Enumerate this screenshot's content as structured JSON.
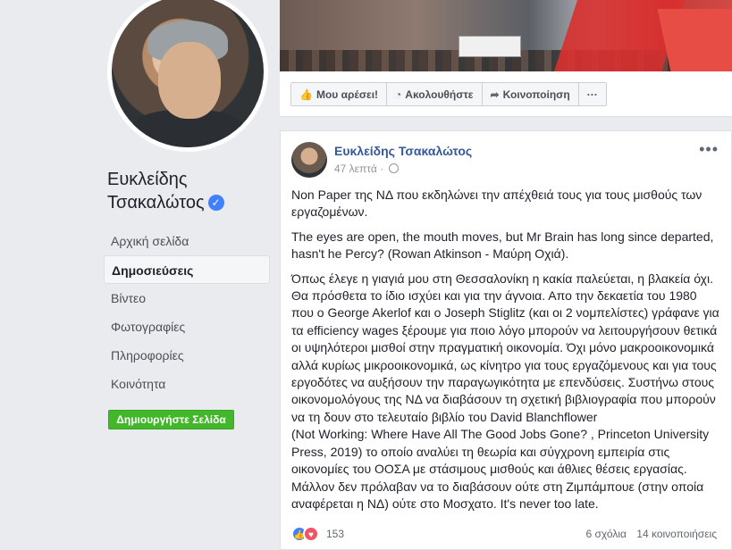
{
  "page": {
    "name_line1": "Ευκλείδης",
    "name_line2": "Τσακαλώτος",
    "verified_glyph": "✓"
  },
  "nav": {
    "items": [
      {
        "label": "Αρχική σελίδα"
      },
      {
        "label": "Δημοσιεύσεις",
        "active": true
      },
      {
        "label": "Βίντεο"
      },
      {
        "label": "Φωτογραφίες"
      },
      {
        "label": "Πληροφορίες"
      },
      {
        "label": "Κοινότητα"
      }
    ],
    "create_page": "Δημιουργήστε Σελίδα"
  },
  "actions": {
    "like": "Μου αρέσει!",
    "follow": "Ακολουθήστε",
    "share": "Κοινοποίηση",
    "more": "···"
  },
  "post": {
    "author": "Ευκλείδης Τσακαλώτος",
    "time": "47 λεπτά",
    "menu": "•••",
    "paragraphs": [
      "Non Paper της ΝΔ που εκδηλώνει την απέχθειά τους για τους μισθούς των εργαζομένων.",
      "The eyes are open, the mouth moves, but Mr Brain has long since departed, hasn't he Percy? (Rowan Atkinson - Μαύρη Οχιά).",
      "Όπως έλεγε η γιαγιά μου στη Θεσσαλονίκη η κακία παλεύεται, η βλακεία όχι. Θα πρόσθετα το ίδιο ισχύει και για την άγνοια. Απο την δεκαετία του 1980 που ο George Akerlof και ο Joseph Stiglitz (και οι 2 νομπελίστες) γράφανε για τα efficiency wages ξέρουμε για ποιο λόγο μπορούν να λειτουργήσουν θετικά οι υψηλότεροι μισθοί στην πραγματική οικονομία. Όχι μόνο μακροοικονομικά αλλά κυρίως μικροοικονομικά, ως κίνητρο για τους εργαζόμενους και για τους εργοδότες να αυξήσουν την παραγωγικότητα με επενδύσεις. Συστήνω στους οικονομολόγους της ΝΔ να διαβάσουν τη σχετική βιβλιογραφία που μπορούν να τη δουν στο τελευταίο βιβλίο του David Blanchflower",
      "(Not Working: Where Have All The Good Jobs Gone? , Princeton University Press, 2019) το οποίο αναλύει τη θεωρία και σύγχρονη εμπειρία στις οικονομίες του ΟΟΣΑ με στάσιμους μισθούς και άθλιες θέσεις εργασίας. Μάλλον δεν πρόλαβαν να το διαβάσουν ούτε στη Ζιμπάμπουε (στην οποία αναφέρεται η ΝΔ) ούτε στο Μοσχατο. It's never too late."
    ],
    "reaction_count": "153",
    "comments": "6 σχόλια",
    "shares": "14 κοινοποιήσεις"
  },
  "icons": {
    "like": "thumbs-up-icon",
    "follow": "rss-icon",
    "share": "share-arrow-icon",
    "globe": "globe-icon"
  },
  "colors": {
    "link": "#365899",
    "green": "#42b72a",
    "like_blue": "#4080ff",
    "love_red": "#f25268"
  }
}
